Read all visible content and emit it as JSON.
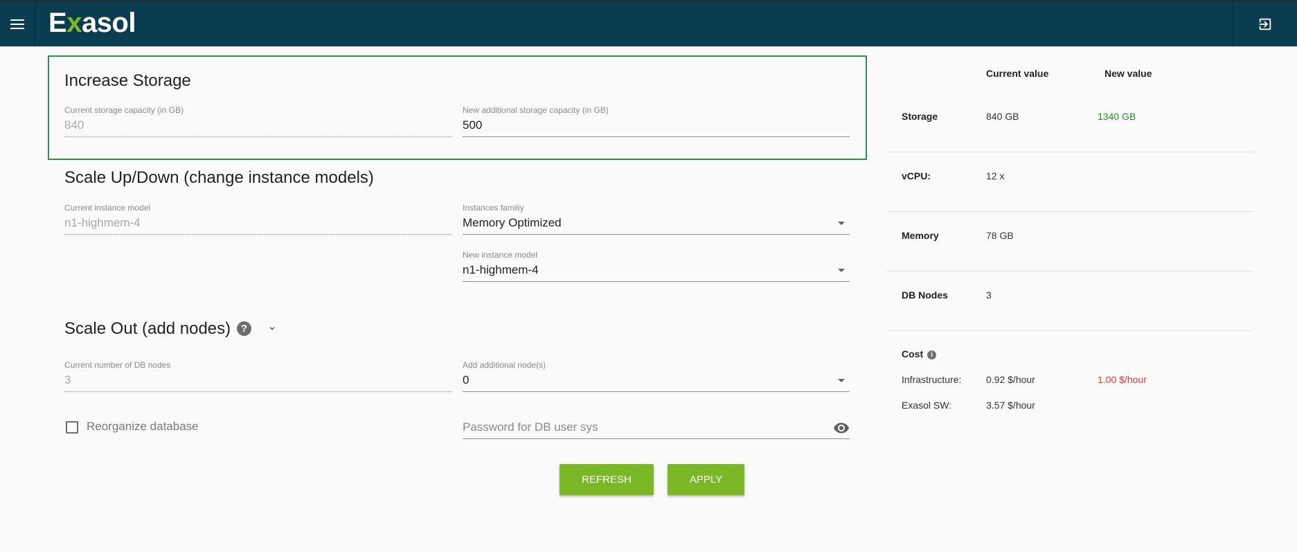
{
  "brand": {
    "logo_pre": "E",
    "logo_x": "x",
    "logo_post": "asol"
  },
  "storage": {
    "title": "Increase Storage",
    "current_label": "Current storage capacity (in GB)",
    "current_value": "840",
    "new_label": "New additional storage capacity (in GB)",
    "new_value": "500"
  },
  "scale_up": {
    "title": "Scale Up/Down (change instance models)",
    "current_label": "Current instance model",
    "current_value": "n1-highmem-4",
    "family_label": "Instances familiy",
    "family_value": "Memory Optimized",
    "new_label": "New instance model",
    "new_value": "n1-highmem-4"
  },
  "scale_out": {
    "title": "Scale Out (add nodes)",
    "help_glyph": "?",
    "current_label": "Current number of DB nodes",
    "current_value": "3",
    "add_label": "Add additional node(s)",
    "add_value": "0",
    "reorganize_label": "Reorganize database",
    "password_placeholder": "Password for DB user sys"
  },
  "buttons": {
    "refresh": "REFRESH",
    "apply": "APPLY"
  },
  "summary": {
    "col_current": "Current value",
    "col_new": "New value",
    "rows": [
      {
        "key": "Storage",
        "current": "840 GB",
        "new": "1340 GB"
      },
      {
        "key": "vCPU:",
        "current": "12 x",
        "new": ""
      },
      {
        "key": "Memory",
        "current": "78 GB",
        "new": ""
      },
      {
        "key": "DB Nodes",
        "current": "3",
        "new": ""
      }
    ],
    "cost": {
      "title": "Cost",
      "info_glyph": "i",
      "infra_label": "Infrastructure:",
      "infra_current": "0.92 $/hour",
      "infra_new": "1.00 $/hour",
      "sw_label": "Exasol SW:",
      "sw_current": "3.57 $/hour"
    }
  },
  "colors": {
    "topbar": "#0a3c52",
    "accent_green": "#7ab828",
    "highlight_border": "#2f8f4e",
    "new_value_increase": "#1e8e1e",
    "new_value_cost": "#e53935"
  },
  "icons": {
    "menu": "menu-icon",
    "logout": "logout-icon",
    "help": "help-icon",
    "chevron": "chevron-down-icon",
    "visibility": "eye-icon",
    "info": "info-icon"
  }
}
